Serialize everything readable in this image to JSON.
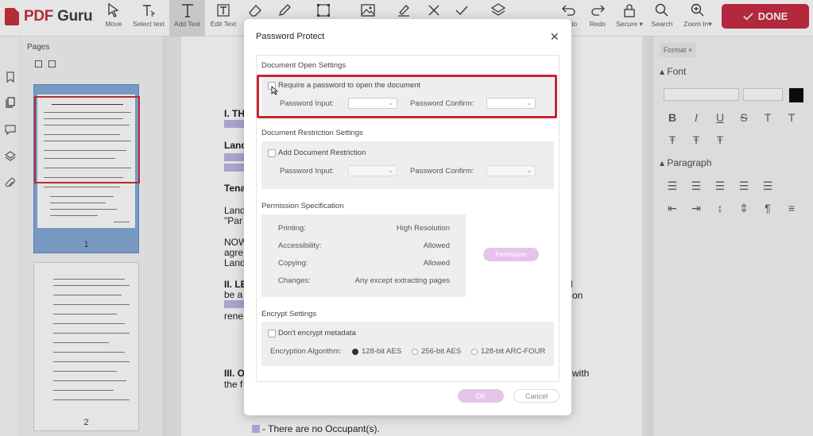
{
  "app": {
    "logo_brand": "PDF",
    "logo_name": "Guru"
  },
  "toolbar": {
    "move": "Move",
    "select_text": "Select text",
    "add_text": "Add Text",
    "edit_text": "Edit Text",
    "undo": "Undo",
    "redo": "Redo",
    "secure": "Secure ▾",
    "search": "Search",
    "zoom_in": "Zoom In▾",
    "done": "DONE"
  },
  "pages_panel": {
    "title": "Pages",
    "pages": [
      {
        "number": "1"
      },
      {
        "number": "2"
      }
    ]
  },
  "document": {
    "heading_1": "I. TH",
    "landlord_heading": "Land",
    "tenant_heading": "Tena",
    "line_1": "Land",
    "line_2": "\"Par",
    "line_3": "NOW",
    "line_4": "agre",
    "line_5": "Land",
    "heading_2": "II. LE",
    "line_6": "be a",
    "line_7": "rene",
    "heading_3": "III. O",
    "line_8": "the f",
    "right_1": "l",
    "right_2": "on",
    "right_3": "with",
    "bottom_line": "- There are no Occupant(s)."
  },
  "format_panel": {
    "tab": "Format",
    "font_section": "Font",
    "paragraph_section": "Paragraph",
    "text_color": "#000000"
  },
  "dialog": {
    "title": "Password Protect",
    "open_settings": {
      "label": "Document Open Settings",
      "require_password": "Require a password to open the document",
      "password_input": "Password Input:",
      "password_confirm": "Password Confirm:"
    },
    "restriction_settings": {
      "label": "Document Restriction Settings",
      "add_restriction": "Add Document Restriction",
      "password_input": "Password Input:",
      "password_confirm": "Password Confirm:"
    },
    "permission": {
      "label": "Permission Specification",
      "rows": [
        {
          "name": "Printing:",
          "value": "High Resolution"
        },
        {
          "name": "Accessibility:",
          "value": "Allowed"
        },
        {
          "name": "Copying:",
          "value": "Allowed"
        },
        {
          "name": "Changes:",
          "value": "Any except extracting pages"
        }
      ],
      "button": "Permission"
    },
    "encrypt": {
      "label": "Encrypt Settings",
      "dont_encrypt_metadata": "Don't encrypt metadata",
      "algorithm_label": "Encryption Algorithm:",
      "options": [
        "128-bit AES",
        "256-bit AES",
        "128-bit ARC-FOUR"
      ],
      "selected": "128-bit AES"
    },
    "ok": "OK",
    "cancel": "Cancel"
  },
  "colors": {
    "accent_red": "#c5213a",
    "button_pink": "#e6c4e9",
    "highlight": "#b7b4e6"
  }
}
